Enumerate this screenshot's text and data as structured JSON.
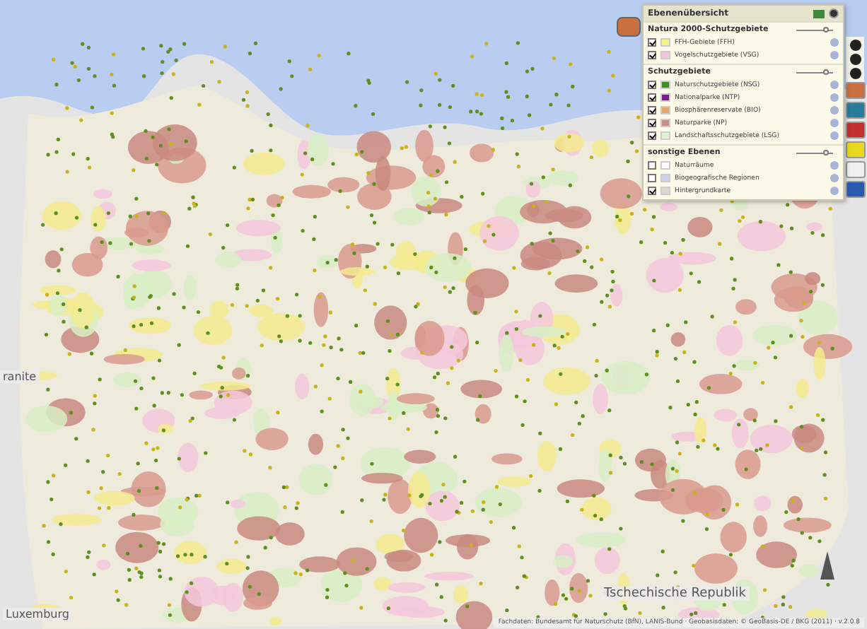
{
  "map": {
    "labels": [
      {
        "kind": "country",
        "text": "Tschechische Republik"
      },
      {
        "kind": "country-left",
        "text": "Luxemburg"
      },
      {
        "kind": "edge",
        "text": "ranite"
      }
    ]
  },
  "layer_panel": {
    "title": "Ebenenübersicht",
    "sections": [
      {
        "title": "Natura 2000-Schutzgebiete",
        "opacity": {
          "level": 0.8
        },
        "layers": [
          {
            "label": "FFH-Gebiete (FFH)",
            "checked": true,
            "color": "#f6f08a"
          },
          {
            "label": "Vogelschutzgebiete (VSG)",
            "checked": true,
            "color": "#f4c4dc"
          }
        ]
      },
      {
        "title": "Schutzgebiete",
        "opacity": {
          "level": 0.8
        },
        "layers": [
          {
            "label": "Naturschutzgebiete (NSG)",
            "checked": true,
            "color": "#3f8f1e"
          },
          {
            "label": "Nationalparke (NTP)",
            "checked": true,
            "color": "#7a1e8c"
          },
          {
            "label": "Biosphärenreservate (BIO)",
            "checked": true,
            "color": "#e2a766"
          },
          {
            "label": "Naturparke (NP)",
            "checked": true,
            "color": "#cf8a86"
          },
          {
            "label": "Landschaftsschutzgebiete (LSG)",
            "checked": true,
            "color": "#dff3cd"
          }
        ]
      },
      {
        "title": "sonstige Ebenen",
        "opacity": {
          "level": 0.8
        },
        "layers": [
          {
            "label": "Naturräume",
            "checked": false,
            "color": "#ffffff"
          },
          {
            "label": "Biogeografische Regionen",
            "checked": false,
            "color": "#c9d3ee"
          },
          {
            "label": "Hintergrundkarte",
            "checked": true,
            "color": "#d8d8d0"
          }
        ]
      }
    ]
  },
  "attribution": "Fachdaten: Bundesamt für Naturschutz (BfN), LANIS-Bund · Geobasisdaten: © GeoBasis-DE / BKG (2011) · v.2.0.8"
}
